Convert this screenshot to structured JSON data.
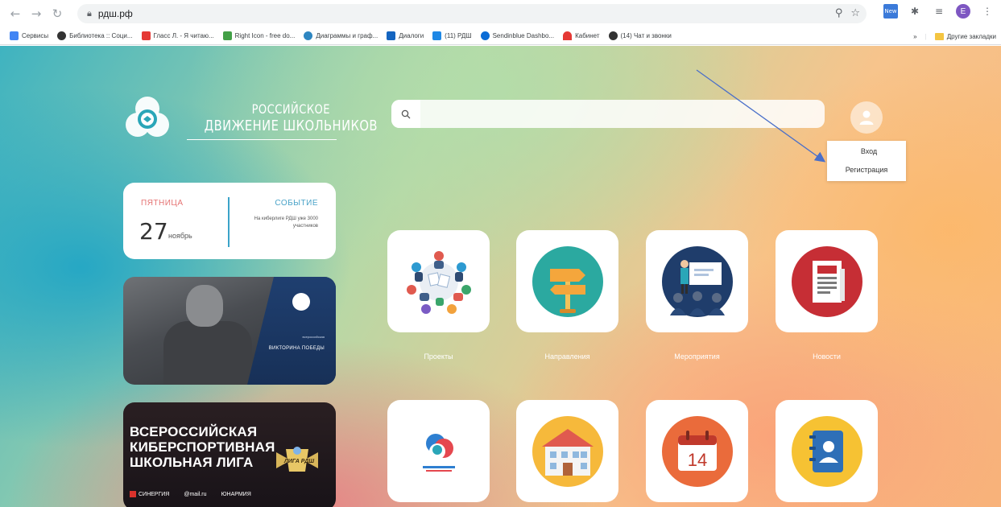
{
  "browser": {
    "url": "рдш.рф",
    "profile_initial": "E",
    "new_badge": "New",
    "bookmarks": [
      {
        "label": "Сервисы",
        "color": "#4285f4"
      },
      {
        "label": "Библиотека :: Соци...",
        "color": "#333333"
      },
      {
        "label": "Гласс Л. - Я читаю...",
        "color": "#e53935"
      },
      {
        "label": "Right Icon - free do...",
        "color": "#43a047"
      },
      {
        "label": "Диаграммы и граф...",
        "color": "#2e86c1"
      },
      {
        "label": "Диалоги",
        "color": "#1565c0"
      },
      {
        "label": "(11) РДШ",
        "color": "#1e88e5"
      },
      {
        "label": "Sendinblue Dashbo...",
        "color": "#0b6cd6"
      },
      {
        "label": "Кабинет",
        "color": "#e53935"
      },
      {
        "label": "(14) Чат и звонки",
        "color": "#333333"
      }
    ],
    "more_bookmarks": "»",
    "other_bookmarks": "Другие закладки"
  },
  "logo": {
    "line1": "РОССИЙСКОЕ",
    "line2": "ДВИЖЕНИЕ ШКОЛЬНИКОВ"
  },
  "search": {
    "placeholder": "",
    "value": ""
  },
  "user_menu": {
    "login": "Вход",
    "register": "Регистрация"
  },
  "date_card": {
    "day_name": "ПЯТНИЦА",
    "day_number": "27",
    "month": "ноябрь",
    "event_title": "СОБЫТИЕ",
    "event_text": "На киберлиге РДШ уже 3000 участников"
  },
  "banner_victory": {
    "small_text": "всероссийская",
    "title": "ВИКТОРИНА ПОБЕДЫ"
  },
  "banner_league": {
    "line1": "ВСЕРОССИЙСКАЯ",
    "line2": "КИБЕРСПОРТИВНАЯ",
    "line3": "ШКОЛЬНАЯ ЛИГА",
    "badge": "ЛИГА РДШ",
    "sponsor1": "СИНЕРГИЯ",
    "sponsor2": "@mail.ru",
    "sponsor3": "ЮНАРМИЯ"
  },
  "tiles": [
    {
      "label": "Проекты"
    },
    {
      "label": "Направления"
    },
    {
      "label": "Мероприятия"
    },
    {
      "label": "Новости"
    }
  ],
  "calendar_day": "14",
  "colors": {
    "accent_teal": "#2ba9a0",
    "accent_red": "#c62e35",
    "accent_orange": "#ea6b3b",
    "accent_yellow": "#f6c233"
  }
}
